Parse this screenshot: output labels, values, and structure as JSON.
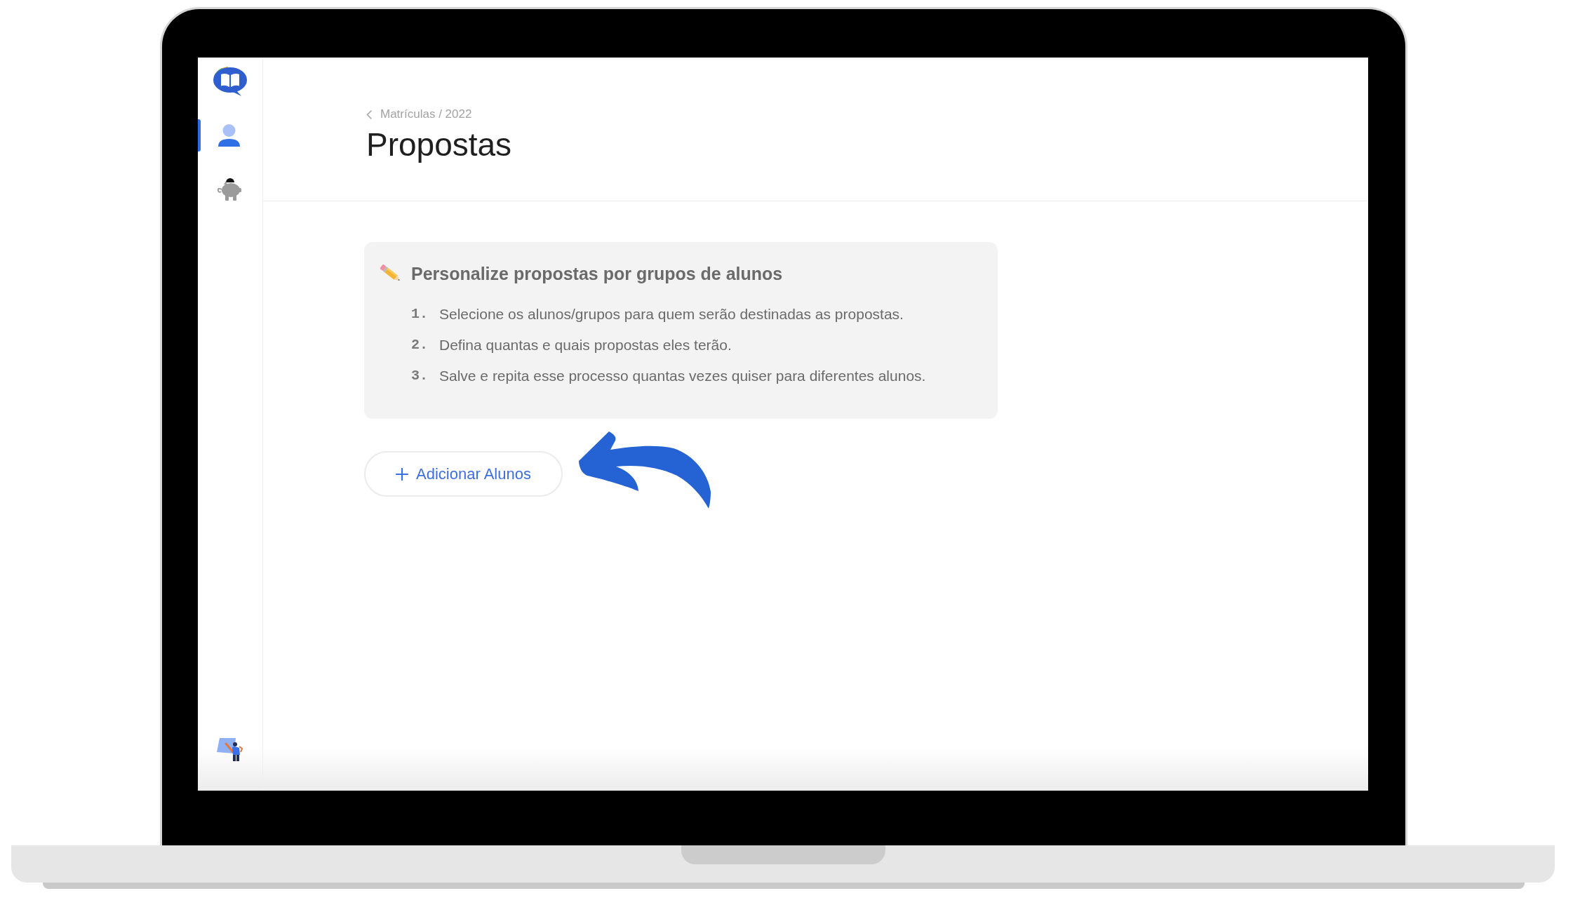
{
  "sidebar": {
    "items": [
      {
        "selected": true
      },
      {
        "selected": false
      }
    ]
  },
  "breadcrumb": "Matrículas / 2022",
  "title": "Propostas",
  "info_card": {
    "heading": "Personalize propostas por grupos de alunos",
    "steps": [
      {
        "number": "1.",
        "text": "Selecione os alunos/grupos para quem serão destinadas as propostas."
      },
      {
        "number": "2.",
        "text": "Defina quantas e quais propostas eles terão."
      },
      {
        "number": "3.",
        "text": "Salve e repita esse processo quantas vezes quiser para diferentes alunos."
      }
    ]
  },
  "add_button": {
    "label": "Adicionar Alunos"
  }
}
